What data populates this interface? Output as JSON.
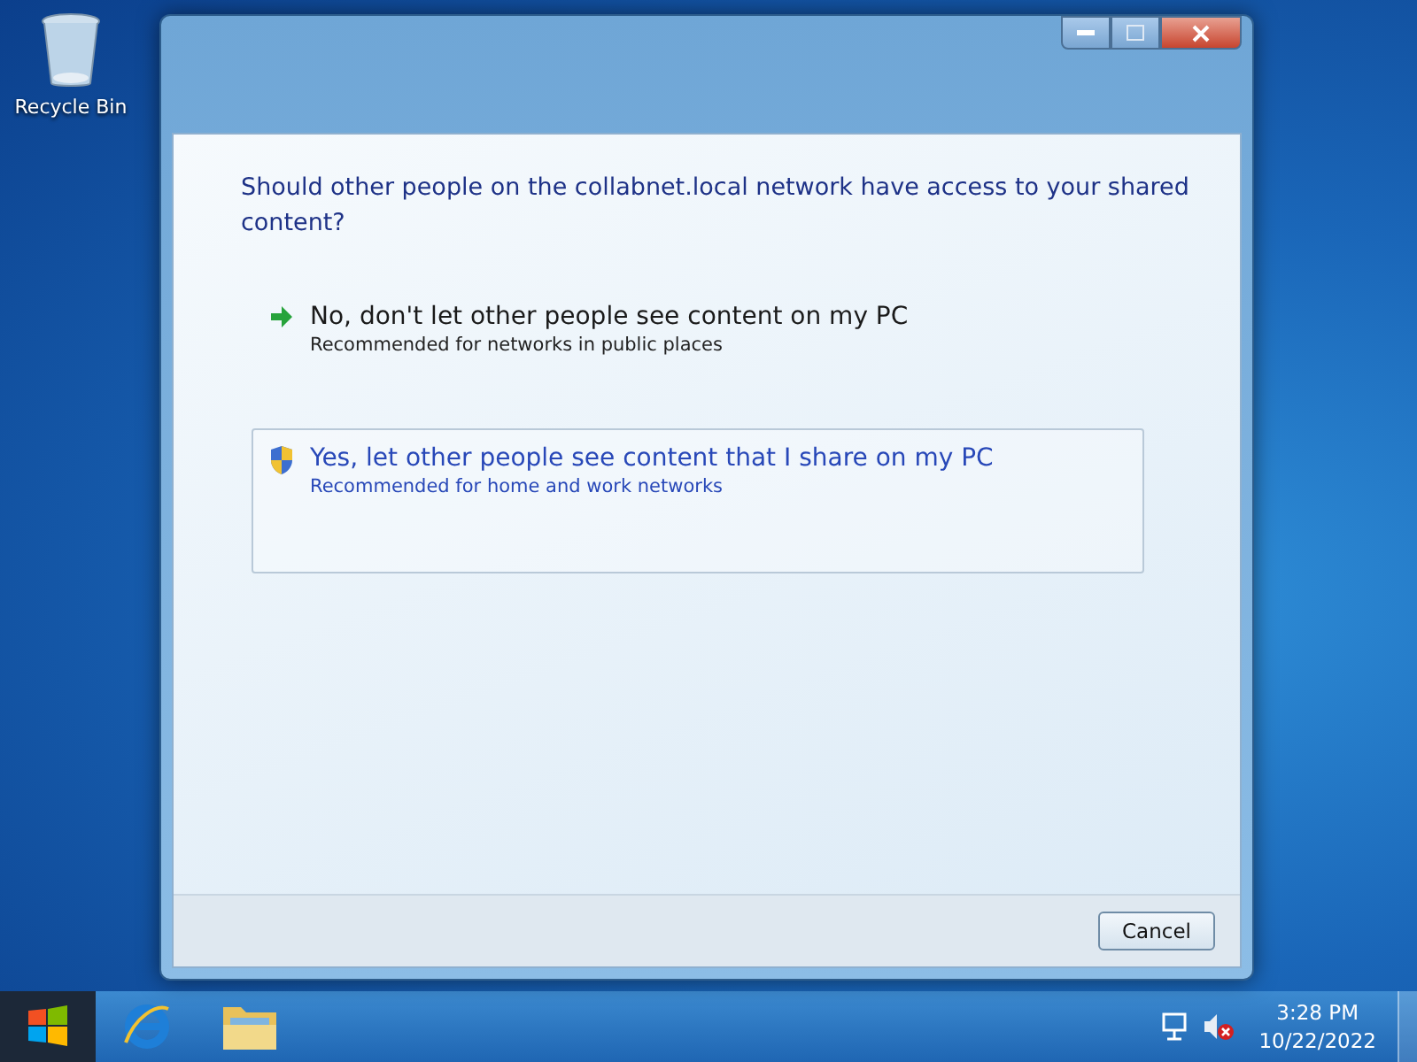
{
  "desktop_icons": [
    {
      "label": "Recycle Bin"
    }
  ],
  "dialog": {
    "question": "Should other people on the collabnet.local network have access to your shared content?",
    "options": [
      {
        "kind": "arrow",
        "title": "No, don't let other people see content on my PC",
        "subtitle": "Recommended for networks in public places",
        "selected": false
      },
      {
        "kind": "shield",
        "title": "Yes, let other people see content that I share on my PC",
        "subtitle": "Recommended for home and work networks",
        "selected": true
      }
    ],
    "buttons": [
      "Cancel"
    ]
  },
  "taskbar": {
    "clock_time": "3:28 PM",
    "clock_date": "10/22/2022"
  }
}
